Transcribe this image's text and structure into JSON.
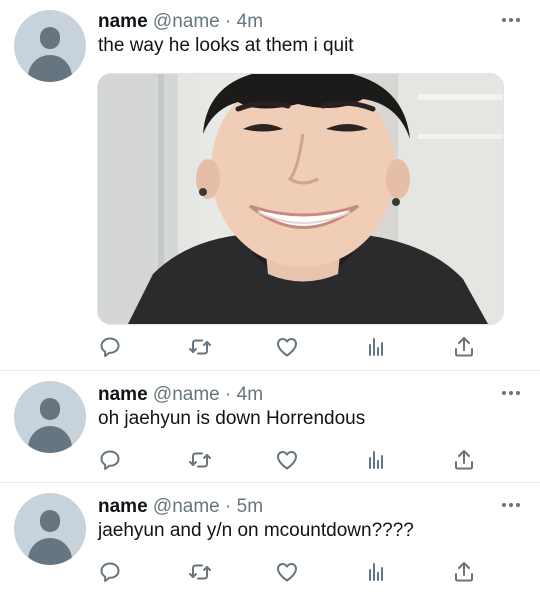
{
  "tweets": [
    {
      "name": "name",
      "handle": "@name",
      "separator": "·",
      "time": "4m",
      "text": "the way he looks at them i quit",
      "has_media": true
    },
    {
      "name": "name",
      "handle": "@name",
      "separator": "·",
      "time": "4m",
      "text": "oh jaehyun is down Horrendous",
      "has_media": false
    },
    {
      "name": "name",
      "handle": "@name",
      "separator": "·",
      "time": "5m",
      "text": "jaehyun and y/n on mcountdown????",
      "has_media": false
    }
  ],
  "icons": {
    "reply": "reply-icon",
    "retweet": "retweet-icon",
    "like": "like-icon",
    "analytics": "analytics-icon",
    "share": "share-icon",
    "more": "more-icon"
  },
  "colors": {
    "icon_gray": "#66757f",
    "text": "#0f1419",
    "avatar_bg": "#c8d2da",
    "divider": "#e6ecf0"
  }
}
